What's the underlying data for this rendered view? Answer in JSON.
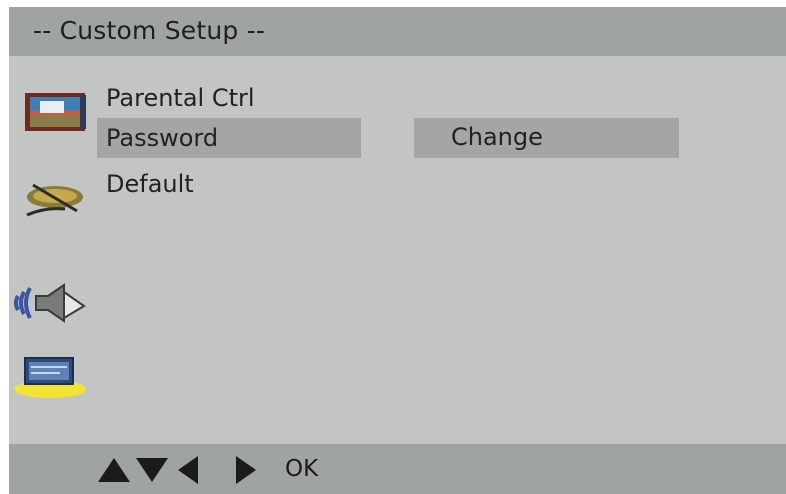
{
  "header": {
    "title": "--  Custom Setup  --"
  },
  "sidebar": {
    "icons": [
      {
        "name": "tv-display-icon"
      },
      {
        "name": "disc-settings-icon"
      },
      {
        "name": "audio-speaker-icon"
      },
      {
        "name": "custom-setup-icon",
        "selected": true
      }
    ]
  },
  "menu": {
    "items": [
      {
        "label": "Parental Ctrl"
      },
      {
        "label": "Password",
        "selected": true
      },
      {
        "label": "Default"
      }
    ],
    "value": {
      "label": "Change"
    }
  },
  "footer": {
    "ok_label": "OK"
  },
  "colors": {
    "screen_bg": "#c3c5c4",
    "bar_bg": "#a0a3a4",
    "highlight_bg": "#a3a5a6",
    "selection_accent": "#f2e335"
  }
}
